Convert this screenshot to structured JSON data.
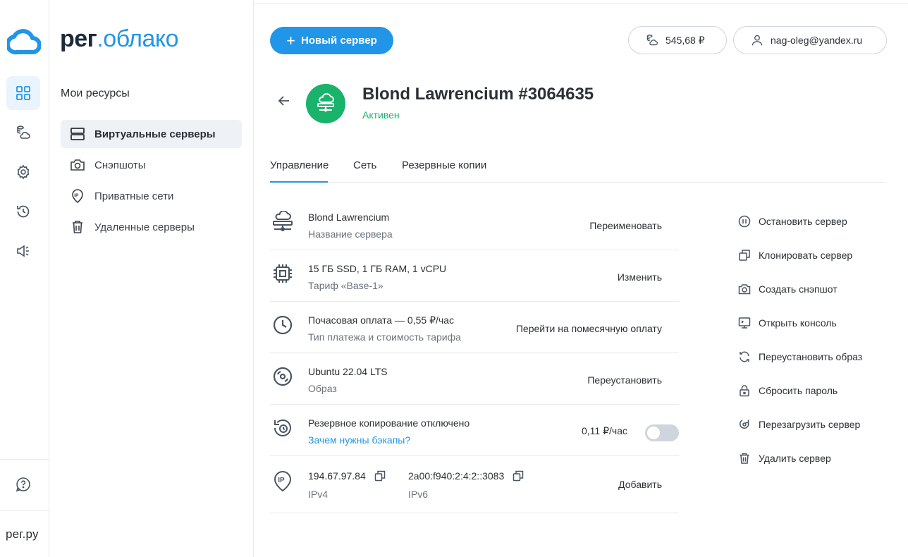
{
  "rail": {
    "footer_brand": "рег.ру"
  },
  "nav": {
    "brand_part1": "рег",
    "brand_part2": ".облако",
    "section_title": "Мои ресурсы",
    "items": [
      {
        "label": "Виртуальные серверы",
        "icon": "server-stack-icon",
        "active": true
      },
      {
        "label": "Снэпшоты",
        "icon": "camera-icon",
        "active": false
      },
      {
        "label": "Приватные сети",
        "icon": "ip-pin-icon",
        "active": false
      },
      {
        "label": "Удаленные серверы",
        "icon": "trash-icon",
        "active": false
      }
    ]
  },
  "header": {
    "new_server_label": "Новый сервер",
    "balance": "545,68 ₽",
    "user_email": "nag-oleg@yandex.ru"
  },
  "server": {
    "title": "Blond Lawrencium #3064635",
    "status": "Активен"
  },
  "tabs": [
    {
      "label": "Управление",
      "active": true
    },
    {
      "label": "Сеть",
      "active": false
    },
    {
      "label": "Резервные копии",
      "active": false
    }
  ],
  "rows": {
    "name": {
      "value": "Blond Lawrencium",
      "caption": "Название сервера",
      "action": "Переименовать"
    },
    "tariff": {
      "value": "15 ГБ SSD, 1 ГБ RAM, 1 vCPU",
      "caption": "Тариф «Base-1»",
      "action": "Изменить"
    },
    "payment": {
      "value": "Почасовая оплата — 0,55 ₽/час",
      "caption": "Тип платежа и стоимость тарифа",
      "action": "Перейти на помесячную оплату"
    },
    "image": {
      "value": "Ubuntu 22.04 LTS",
      "caption": "Образ",
      "action": "Переустановить"
    },
    "backup": {
      "value": "Резервное копирование отключено",
      "caption": "Зачем нужны бэкапы?",
      "price": "0,11 ₽/час",
      "enabled": false
    },
    "ip": {
      "ipv4": "194.67.97.84",
      "ipv4_caption": "IPv4",
      "ipv6": "2a00:f940:2:4:2::3083",
      "ipv6_caption": "IPv6",
      "action": "Добавить"
    }
  },
  "side_actions": [
    {
      "label": "Остановить сервер",
      "icon": "pause-circle-icon"
    },
    {
      "label": "Клонировать сервер",
      "icon": "clone-icon"
    },
    {
      "label": "Создать снэпшот",
      "icon": "camera-plus-icon"
    },
    {
      "label": "Открыть консоль",
      "icon": "console-icon"
    },
    {
      "label": "Переустановить образ",
      "icon": "refresh-icon"
    },
    {
      "label": "Сбросить пароль",
      "icon": "lock-icon"
    },
    {
      "label": "Перезагрузить сервер",
      "icon": "reboot-icon"
    },
    {
      "label": "Удалить сервер",
      "icon": "trash-icon"
    }
  ],
  "colors": {
    "accent": "#2196e8",
    "status_green": "#19b36b",
    "text": "#2b3036",
    "muted": "#6b727b"
  }
}
